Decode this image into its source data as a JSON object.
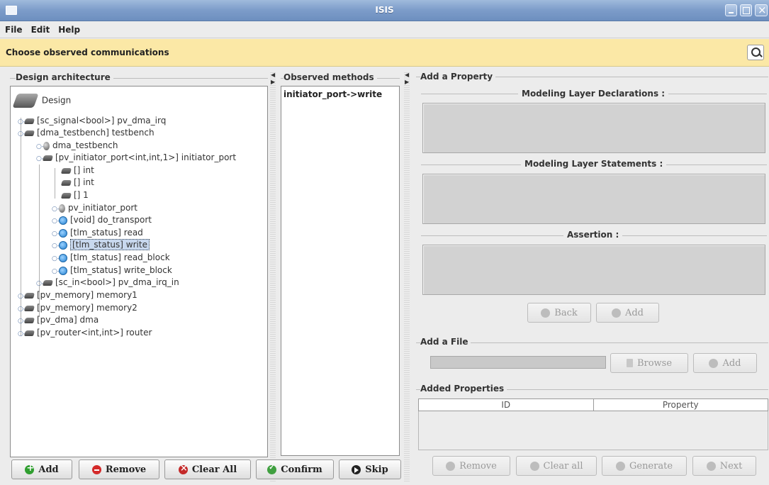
{
  "window": {
    "title": "ISIS"
  },
  "menu": {
    "items": [
      "File",
      "Edit",
      "Help"
    ]
  },
  "banner": {
    "text": "Choose observed communications",
    "icon": "magnifier-icon"
  },
  "design_panel": {
    "title": "Design architecture",
    "root": "Design",
    "rows": [
      "[sc_signal<bool>] pv_dma_irq",
      "[dma_testbench] testbench",
      "dma_testbench",
      "[pv_initiator_port<int,int,1>] initiator_port",
      "[] int",
      "[] int",
      "[] 1",
      "pv_initiator_port",
      "[void] do_transport",
      "[tlm_status] read",
      "[tlm_status] write",
      "[tlm_status] read_block",
      "[tlm_status] write_block",
      "[sc_in<bool>] pv_dma_irq_in",
      "[pv_memory] memory1",
      "[pv_memory] memory2",
      "[pv_dma] dma",
      "[pv_router<int,int>] router"
    ],
    "selected_row": "[tlm_status] write"
  },
  "observed_panel": {
    "title": "Observed methods",
    "items": [
      "initiator_port->write"
    ]
  },
  "property_panel": {
    "title": "Add a Property",
    "declarations_label": "Modeling Layer Declarations :",
    "statements_label": "Modeling Layer Statements :",
    "assertion_label": "Assertion :",
    "back_label": "Back",
    "add_label": "Add"
  },
  "file_panel": {
    "title": "Add a File",
    "browse_label": "Browse",
    "add_label": "Add"
  },
  "added_panel": {
    "title": "Added Properties",
    "columns": [
      "ID",
      "Property"
    ],
    "remove_label": "Remove",
    "clear_label": "Clear all",
    "generate_label": "Generate",
    "next_label": "Next"
  },
  "bottom_buttons": {
    "add": "Add",
    "remove": "Remove",
    "clear_all": "Clear All",
    "confirm": "Confirm",
    "skip": "Skip"
  }
}
